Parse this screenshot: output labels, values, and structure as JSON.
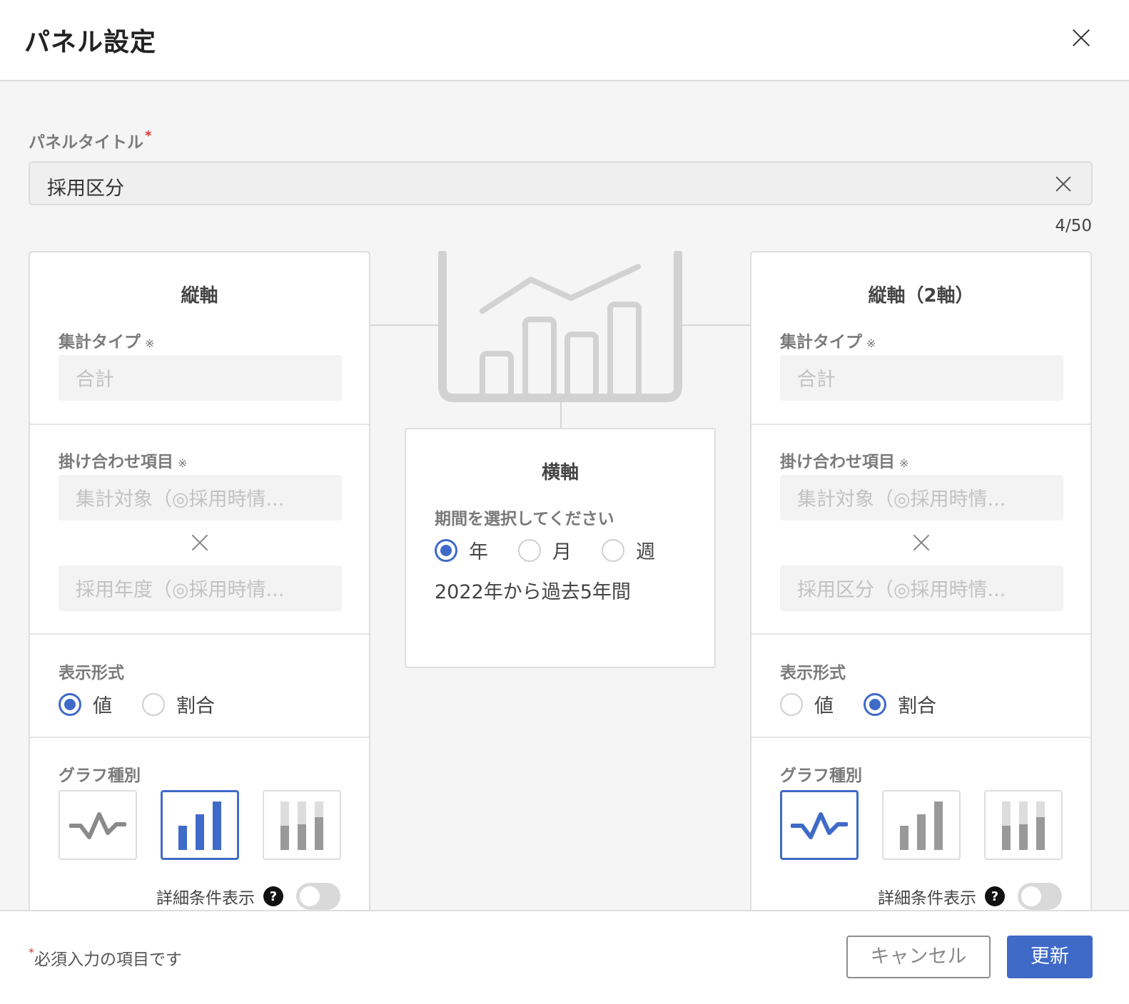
{
  "header": {
    "title": "パネル設定"
  },
  "panel_title_field": {
    "label": "パネルタイトル",
    "required_mark": "*",
    "value": "採用区分",
    "counter": "4/50"
  },
  "y_axis": {
    "title": "縦軸",
    "aggregation_label": "集計タイプ",
    "note_mark": "※",
    "aggregation_value": "合計",
    "combination_label": "掛け合わせ項目",
    "combination_1": "集計対象（◎採用時情...",
    "combination_2": "採用年度（◎採用時情...",
    "display_label": "表示形式",
    "display_options": [
      "値",
      "割合"
    ],
    "display_selected": "値",
    "graph_label": "グラフ種別",
    "graph_selected": "bar",
    "detail_label": "詳細条件表示",
    "help_text": "?",
    "detail_enabled": false
  },
  "x_axis": {
    "title": "横軸",
    "period_label": "期間を選択してください",
    "period_options": [
      "年",
      "月",
      "週"
    ],
    "period_selected": "年",
    "period_text": "2022年から過去5年間"
  },
  "y2_axis": {
    "title": "縦軸（2軸）",
    "aggregation_label": "集計タイプ",
    "note_mark": "※",
    "aggregation_value": "合計",
    "combination_label": "掛け合わせ項目",
    "combination_1": "集計対象（◎採用時情...",
    "combination_2": "採用区分（◎採用時情...",
    "display_label": "表示形式",
    "display_options": [
      "値",
      "割合"
    ],
    "display_selected": "割合",
    "graph_label": "グラフ種別",
    "graph_selected": "line",
    "detail_label": "詳細条件表示",
    "help_text": "?",
    "detail_enabled": false
  },
  "footer": {
    "required_mark": "*",
    "required_note": "必須入力の項目です",
    "cancel_label": "キャンセル",
    "update_label": "更新"
  },
  "colors": {
    "accent": "#3f6ac8",
    "border": "#dedede",
    "muted": "#7a7a7a"
  },
  "icons": [
    "close-icon",
    "clear-icon",
    "multiply-icon",
    "line-chart-icon",
    "bar-chart-icon",
    "stacked-bar-icon",
    "help-icon"
  ]
}
